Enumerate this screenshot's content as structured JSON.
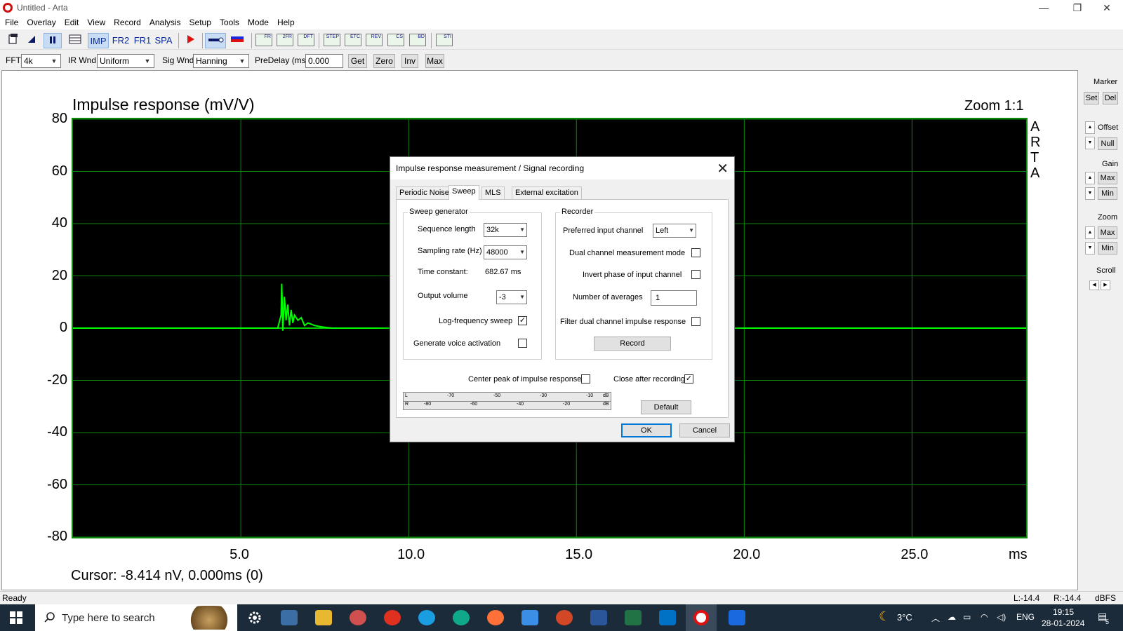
{
  "window": {
    "title": "Untitled - Arta"
  },
  "menu": [
    "File",
    "Overlay",
    "Edit",
    "View",
    "Record",
    "Analysis",
    "Setup",
    "Tools",
    "Mode",
    "Help"
  ],
  "toolbar": {
    "imp": "IMP",
    "fr2": "FR2",
    "fr1": "FR1",
    "spa": "SPA",
    "chart_icons": [
      "FR",
      "2FR",
      "DFT",
      "STEP",
      "ETC",
      "REV",
      "CS",
      "BD",
      "STI"
    ]
  },
  "toolbar2": {
    "fft_label": "FFT",
    "fft_value": "4k",
    "irwnd_label": "IR Wnd",
    "irwnd_value": "Uniform",
    "sigwnd_label": "Sig Wnd",
    "sigwnd_value": "Hanning",
    "predelay_label": "PreDelay (ms)",
    "predelay_value": "0.000",
    "get": "Get",
    "zero": "Zero",
    "inv": "Inv",
    "max": "Max"
  },
  "plot": {
    "title": "Impulse response (mV/V)",
    "zoom": "Zoom 1:1",
    "cursor": "Cursor: -8.414 nV, 0.000ms (0)",
    "brand_letters": [
      "A",
      "R",
      "T",
      "A"
    ],
    "xunit": "ms"
  },
  "chart_data": {
    "type": "line",
    "title": "Impulse response (mV/V)",
    "xlabel": "ms",
    "ylabel": "",
    "xlim": [
      0,
      28.4
    ],
    "ylim": [
      -80,
      80
    ],
    "yticks": [
      "80",
      "60",
      "40",
      "20",
      "0",
      "-20",
      "-40",
      "-60",
      "-80"
    ],
    "ytick_values": [
      80,
      60,
      40,
      20,
      0,
      -20,
      -40,
      -60,
      -80
    ],
    "xticks": [
      "5.0",
      "10.0",
      "15.0",
      "20.0",
      "25.0"
    ],
    "xtick_values": [
      5,
      10,
      15,
      20,
      25
    ],
    "grid": true,
    "series": [
      {
        "color": "#00ff00",
        "x": [
          0,
          6.1,
          6.2,
          6.22,
          6.25,
          6.3,
          6.35,
          6.4,
          6.45,
          6.5,
          6.55,
          6.6,
          6.7,
          6.8,
          6.9,
          7.0,
          7.2,
          7.4,
          7.7,
          28.4
        ],
        "y": [
          0,
          0,
          5,
          17,
          -1,
          12,
          3,
          9,
          1,
          7,
          2,
          5,
          3,
          4,
          1,
          2,
          1,
          0.5,
          0,
          0
        ]
      }
    ]
  },
  "side_panel": {
    "marker": "Marker",
    "set": "Set",
    "del": "Del",
    "offset": "Offset",
    "null": "Null",
    "gain": "Gain",
    "gain_max": "Max",
    "gain_min": "Min",
    "zoom": "Zoom",
    "zoom_max": "Max",
    "zoom_min": "Min",
    "scroll": "Scroll"
  },
  "status": {
    "left": "Ready",
    "l": "L:-14.4",
    "r": "R:-14.4",
    "unit": "dBFS"
  },
  "dialog": {
    "title": "Impulse response measurement / Signal recording",
    "tabs": [
      "Periodic Noise",
      "Sweep",
      "MLS",
      "External excitation"
    ],
    "active_tab": "Sweep",
    "sweep": {
      "group": "Sweep generator",
      "seq_label": "Sequence length",
      "seq_value": "32k",
      "rate_label": "Sampling rate (Hz)",
      "rate_value": "48000",
      "tc_label": "Time constant:",
      "tc_value": "682.67 ms",
      "vol_label": "Output volume",
      "vol_value": "-3",
      "logsweep_label": "Log-frequency sweep",
      "logsweep_checked": true,
      "voice_label": "Generate voice activation",
      "voice_checked": false
    },
    "recorder": {
      "group": "Recorder",
      "pref_label": "Preferred input channel",
      "pref_value": "Left",
      "dual_label": "Dual channel measurement mode",
      "dual_checked": false,
      "invert_label": "Invert phase of input channel",
      "invert_checked": false,
      "avg_label": "Number of averages",
      "avg_value": "1",
      "filter_label": "Filter dual channel impulse response",
      "filter_checked": false,
      "record": "Record"
    },
    "center_label": "Center peak of impulse response",
    "center_checked": false,
    "close_label": "Close after recording",
    "close_checked": true,
    "meter": {
      "row_l": [
        "L",
        "-70",
        "-50",
        "-30",
        "-10",
        "dB"
      ],
      "row_r": [
        "R",
        "-80",
        "-60",
        "-40",
        "-20",
        "dB"
      ]
    },
    "default": "Default",
    "ok": "OK",
    "cancel": "Cancel",
    "check_mark": "✓"
  },
  "taskbar": {
    "search_placeholder": "Type here to search",
    "temperature": "3°C",
    "lang": "ENG",
    "time": "19:15",
    "date": "28-01-2024",
    "notif_count": "5"
  }
}
